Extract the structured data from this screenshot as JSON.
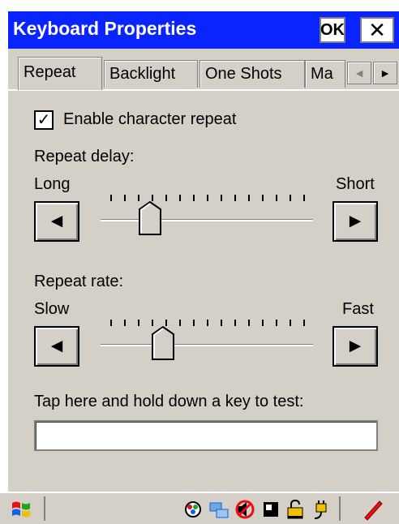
{
  "window": {
    "title": "Keyboard Properties",
    "ok_label": "OK",
    "close_label": "✕"
  },
  "tabs": [
    {
      "label": "Repeat",
      "active": true
    },
    {
      "label": "Backlight",
      "active": false
    },
    {
      "label": "One Shots",
      "active": false
    },
    {
      "label": "Ma",
      "active": false
    }
  ],
  "tab_scroll": {
    "left": "◄",
    "right": "►"
  },
  "repeat": {
    "enable_checked": true,
    "enable_label": "Enable character repeat",
    "delay": {
      "label": "Repeat delay:",
      "min_label": "Long",
      "max_label": "Short",
      "level": 0.2
    },
    "rate": {
      "label": "Repeat rate:",
      "min_label": "Slow",
      "max_label": "Fast",
      "level": 0.27
    },
    "test_label": "Tap here and hold down a key to test:",
    "test_value": ""
  },
  "buttons": {
    "decrease": "◄",
    "increase": "►"
  },
  "colors": {
    "titlebar": "#0a24ff",
    "dialog": "#d4d0c8",
    "title_text": "#ffffff"
  },
  "taskbar": {
    "start_icon": "windows-flag-icon",
    "tray_icons": [
      "network-icon",
      "connectivity-icon",
      "volume-muted-icon",
      "battery-icon",
      "lock-icon",
      "power-plug-icon",
      "stylus-icon"
    ]
  }
}
